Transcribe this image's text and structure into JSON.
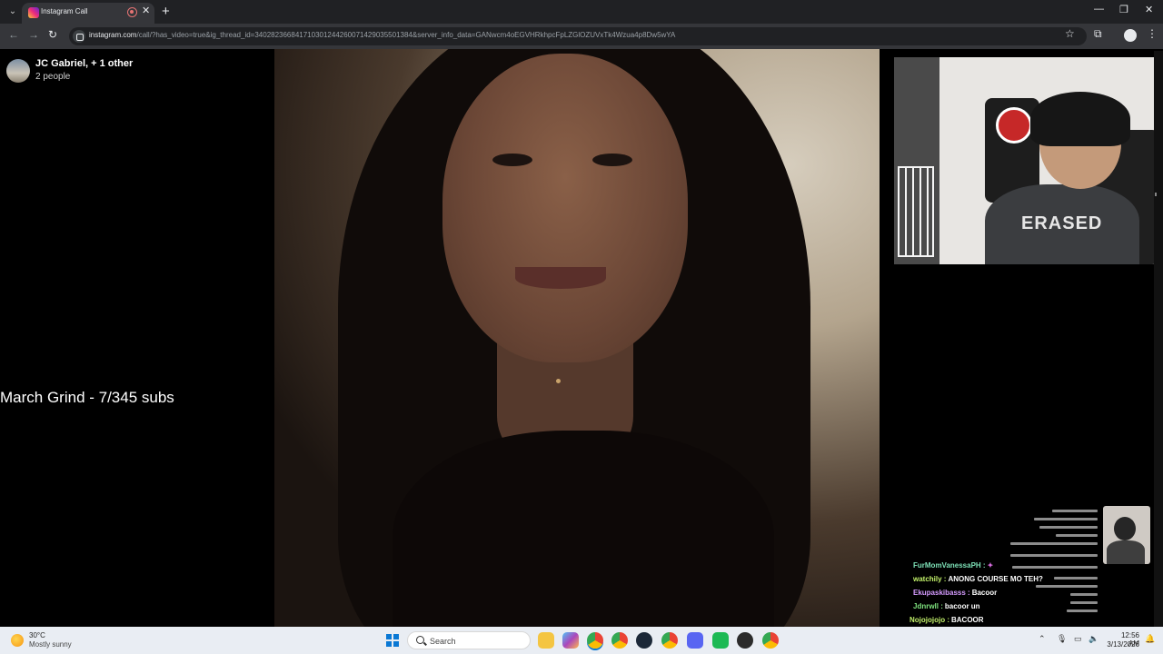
{
  "browser": {
    "tab_title": "Instagram Call",
    "url_host": "instagram.com",
    "url_path": "/call/?has_video=true&ig_thread_id=340282366841710301244260071429035501384&server_info_data=GANwcm4oEGVHRkhpcFpLZGlOZUVxTk4Wzua4p8Dw5wYA"
  },
  "call": {
    "title": "JC Gabriel, + 1 other",
    "participants": "2 people"
  },
  "overlay": {
    "stream_text": "March Grind - 7/345 subs",
    "pip_shirt_text": "ERASED"
  },
  "chat": [
    {
      "user": "FurMomVanessaPH :",
      "message": "",
      "color": "#7ee2b8"
    },
    {
      "user": "watchily :",
      "message": "ANONG COURSE MO TEH?",
      "color": "#c2f06a"
    },
    {
      "user": "Ekupaskibasss :",
      "message": "Bacoor",
      "color": "#d59bff"
    },
    {
      "user": "Jdnrwll :",
      "message": "bacoor un",
      "color": "#7ee27e"
    },
    {
      "user": "Nojojojojo :",
      "message": "BACOOR",
      "color": "#c2f06a"
    }
  ],
  "taskbar": {
    "weather_temp": "30°C",
    "weather_desc": "Mostly sunny",
    "search_placeholder": "Search",
    "time": "12:56 AM",
    "date": "3/13/2026"
  },
  "colors": {
    "chrome_dark": "#202124",
    "chrome_toolbar": "#35363a",
    "taskbar": "#e9edf3"
  }
}
